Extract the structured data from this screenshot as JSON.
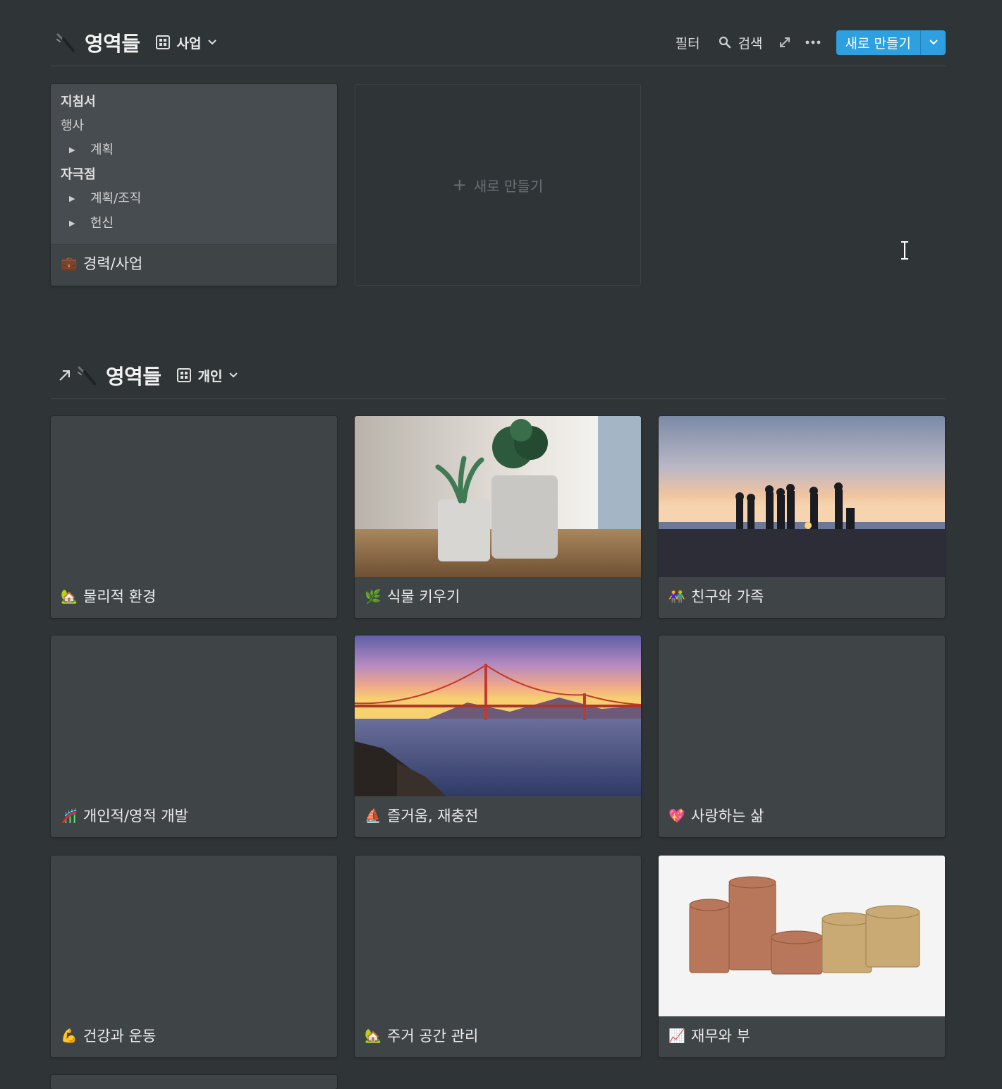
{
  "section1": {
    "title": "영역들",
    "view": "사업",
    "toolbar": {
      "filter": "필터",
      "search": "검색",
      "new_button": "새로 만들기"
    },
    "tree_card": {
      "groups": [
        {
          "heading": "지침서"
        },
        {
          "leaf": "행사"
        },
        {
          "toggle": "계획"
        },
        {
          "heading": "자극점"
        },
        {
          "toggle": "계획/조직"
        },
        {
          "toggle": "헌신"
        }
      ],
      "h1": "지침서",
      "l1": "행사",
      "t1": "계획",
      "h2": "자극점",
      "t2": "계획/조직",
      "t3": "헌신",
      "title": "경력/사업",
      "emoji": "💼"
    },
    "new_card_label": "새로 만들기"
  },
  "section2": {
    "title": "영역들",
    "view": "개인",
    "cards": [
      {
        "emoji": "🏡",
        "title": "물리적 환경",
        "cover": "none"
      },
      {
        "emoji": "🌿",
        "title": "식물 키우기",
        "cover": "succulent-plants-photo"
      },
      {
        "emoji": "👫",
        "title": "친구와 가족",
        "cover": "friends-beach-sunset-photo"
      },
      {
        "emoji": "🎢",
        "title": "개인적/영적 개발",
        "cover": "none"
      },
      {
        "emoji": "⛵",
        "title": "즐거움, 재충전",
        "cover": "golden-gate-bridge-photo"
      },
      {
        "emoji": "💖",
        "title": "사랑하는 삶",
        "cover": "none"
      },
      {
        "emoji": "💪",
        "title": "건강과 운동",
        "cover": "none"
      },
      {
        "emoji": "🏡",
        "title": "주거 공간 관리",
        "cover": "none"
      },
      {
        "emoji": "📈",
        "title": "재무와 부",
        "cover": "coins-stacks-photo"
      }
    ]
  },
  "colors": {
    "background": "#2f3437",
    "card": "#3f4447",
    "accent": "#2ea0e0"
  }
}
